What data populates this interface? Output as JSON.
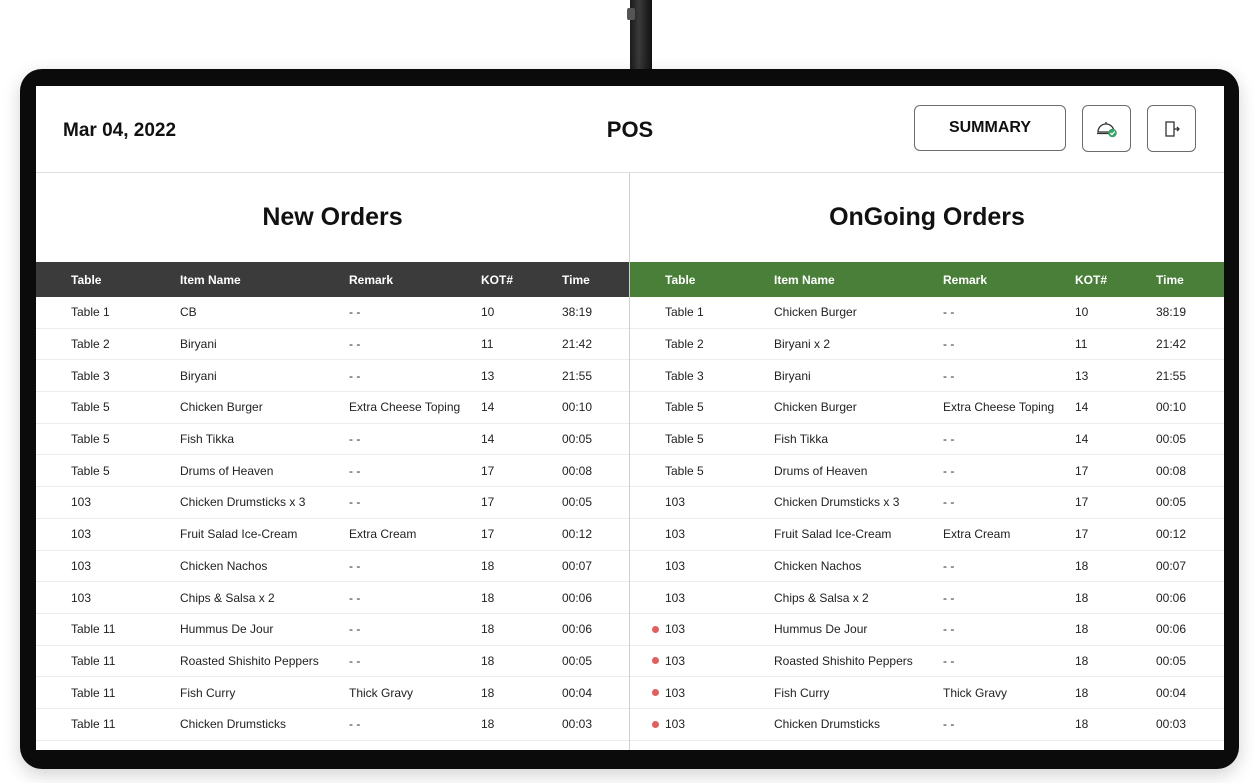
{
  "header": {
    "date": "Mar 04, 2022",
    "title": "POS",
    "summary_label": "SUMMARY",
    "icons": [
      "dish-check-icon",
      "exit-door-icon"
    ]
  },
  "columns": {
    "table": "Table",
    "item": "Item Name",
    "remark": "Remark",
    "kot": "KOT#",
    "time": "Time"
  },
  "colors": {
    "new_header_bg": "#3b3b3b",
    "ongoing_header_bg": "#4a7f3a",
    "alert_dot": "#e06060",
    "check_badge": "#3aa36a"
  },
  "new_orders": {
    "title": "New Orders",
    "rows": [
      {
        "table": "Table 1",
        "item": "CB",
        "remark": "- -",
        "kot": "10",
        "time": "38:19"
      },
      {
        "table": "Table 2",
        "item": "Biryani",
        "remark": "- -",
        "kot": "11",
        "time": "21:42"
      },
      {
        "table": "Table 3",
        "item": "Biryani",
        "remark": "- -",
        "kot": "13",
        "time": "21:55"
      },
      {
        "table": "Table 5",
        "item": "Chicken Burger",
        "remark": "Extra Cheese Toping",
        "kot": "14",
        "time": "00:10"
      },
      {
        "table": "Table 5",
        "item": "Fish Tikka",
        "remark": "- -",
        "kot": "14",
        "time": "00:05"
      },
      {
        "table": "Table 5",
        "item": "Drums of Heaven",
        "remark": "- -",
        "kot": "17",
        "time": "00:08"
      },
      {
        "table": "103",
        "item": "Chicken Drumsticks x 3",
        "remark": "- -",
        "kot": "17",
        "time": "00:05"
      },
      {
        "table": "103",
        "item": "Fruit Salad Ice-Cream",
        "remark": "Extra Cream",
        "kot": "17",
        "time": "00:12"
      },
      {
        "table": "103",
        "item": "Chicken Nachos",
        "remark": "- -",
        "kot": "18",
        "time": "00:07"
      },
      {
        "table": "103",
        "item": "Chips & Salsa x 2",
        "remark": "- -",
        "kot": "18",
        "time": "00:06"
      },
      {
        "table": "Table 11",
        "item": "Hummus De Jour",
        "remark": "- -",
        "kot": "18",
        "time": "00:06"
      },
      {
        "table": "Table 11",
        "item": "Roasted Shishito Peppers",
        "remark": "- -",
        "kot": "18",
        "time": "00:05"
      },
      {
        "table": "Table 11",
        "item": "Fish Curry",
        "remark": "Thick Gravy",
        "kot": "18",
        "time": "00:04"
      },
      {
        "table": "Table 11",
        "item": "Chicken Drumsticks",
        "remark": "- -",
        "kot": "18",
        "time": "00:03"
      }
    ]
  },
  "ongoing_orders": {
    "title": "OnGoing Orders",
    "rows": [
      {
        "table": "Table 1",
        "item": "Chicken Burger",
        "remark": "- -",
        "kot": "10",
        "time": "38:19",
        "alert": false
      },
      {
        "table": "Table 2",
        "item": "Biryani x 2",
        "remark": "- -",
        "kot": "11",
        "time": "21:42",
        "alert": false
      },
      {
        "table": "Table 3",
        "item": "Biryani",
        "remark": "- -",
        "kot": "13",
        "time": "21:55",
        "alert": false
      },
      {
        "table": "Table 5",
        "item": "Chicken Burger",
        "remark": "Extra Cheese Toping",
        "kot": "14",
        "time": "00:10",
        "alert": false
      },
      {
        "table": "Table 5",
        "item": "Fish Tikka",
        "remark": "- -",
        "kot": "14",
        "time": "00:05",
        "alert": false
      },
      {
        "table": "Table 5",
        "item": "Drums of Heaven",
        "remark": "- -",
        "kot": "17",
        "time": "00:08",
        "alert": false
      },
      {
        "table": "103",
        "item": "Chicken Drumsticks x 3",
        "remark": "- -",
        "kot": "17",
        "time": "00:05",
        "alert": false
      },
      {
        "table": "103",
        "item": "Fruit Salad Ice-Cream",
        "remark": "Extra Cream",
        "kot": "17",
        "time": "00:12",
        "alert": false
      },
      {
        "table": "103",
        "item": "Chicken Nachos",
        "remark": "- -",
        "kot": "18",
        "time": "00:07",
        "alert": false
      },
      {
        "table": "103",
        "item": "Chips & Salsa x 2",
        "remark": "- -",
        "kot": "18",
        "time": "00:06",
        "alert": false
      },
      {
        "table": "103",
        "item": "Hummus De Jour",
        "remark": "- -",
        "kot": "18",
        "time": "00:06",
        "alert": true
      },
      {
        "table": "103",
        "item": "Roasted Shishito Peppers",
        "remark": "- -",
        "kot": "18",
        "time": "00:05",
        "alert": true
      },
      {
        "table": "103",
        "item": "Fish Curry",
        "remark": "Thick Gravy",
        "kot": "18",
        "time": "00:04",
        "alert": true
      },
      {
        "table": "103",
        "item": "Chicken Drumsticks",
        "remark": "- -",
        "kot": "18",
        "time": "00:03",
        "alert": true
      }
    ]
  }
}
